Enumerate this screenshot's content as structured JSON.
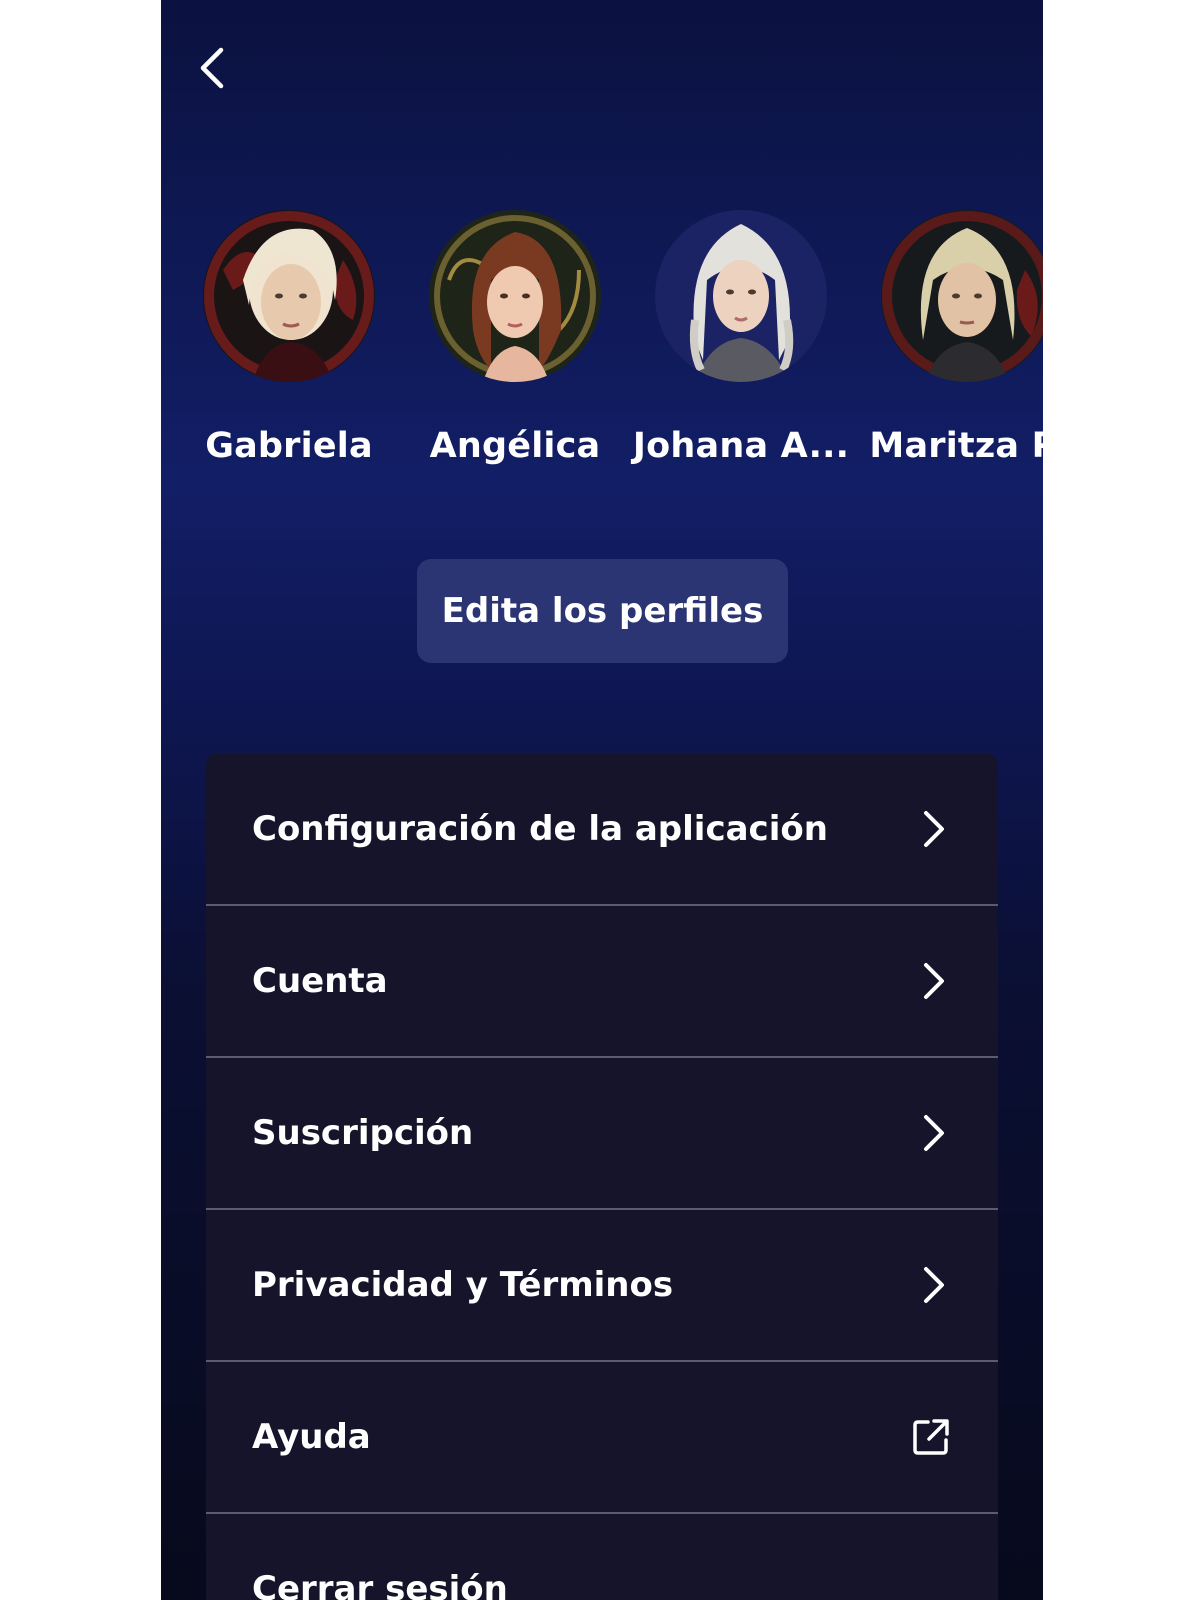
{
  "profiles": [
    {
      "name": "Gabriela",
      "icon": "avatar-portrait"
    },
    {
      "name": "Angélica",
      "icon": "avatar-portrait"
    },
    {
      "name": "Johana A...",
      "icon": "avatar-portrait"
    },
    {
      "name": "Maritza P.",
      "icon": "avatar-portrait"
    }
  ],
  "edit_button": {
    "label": "Edita los perfiles"
  },
  "menu": {
    "items": [
      {
        "label": "Configuración de la aplicación",
        "icon": "chevron-right-icon"
      },
      {
        "label": "Cuenta",
        "icon": "chevron-right-icon"
      },
      {
        "label": "Suscripción",
        "icon": "chevron-right-icon"
      },
      {
        "label": "Privacidad y Términos",
        "icon": "chevron-right-icon"
      },
      {
        "label": "Ayuda",
        "icon": "external-link-icon"
      },
      {
        "label": "Cerrar sesión",
        "icon": ""
      }
    ]
  },
  "colors": {
    "background_top": "#121e66",
    "background_bottom": "#070a1c",
    "button": "#2b3573",
    "menu_bg": "#15142a",
    "divider": "#5a5c70"
  }
}
